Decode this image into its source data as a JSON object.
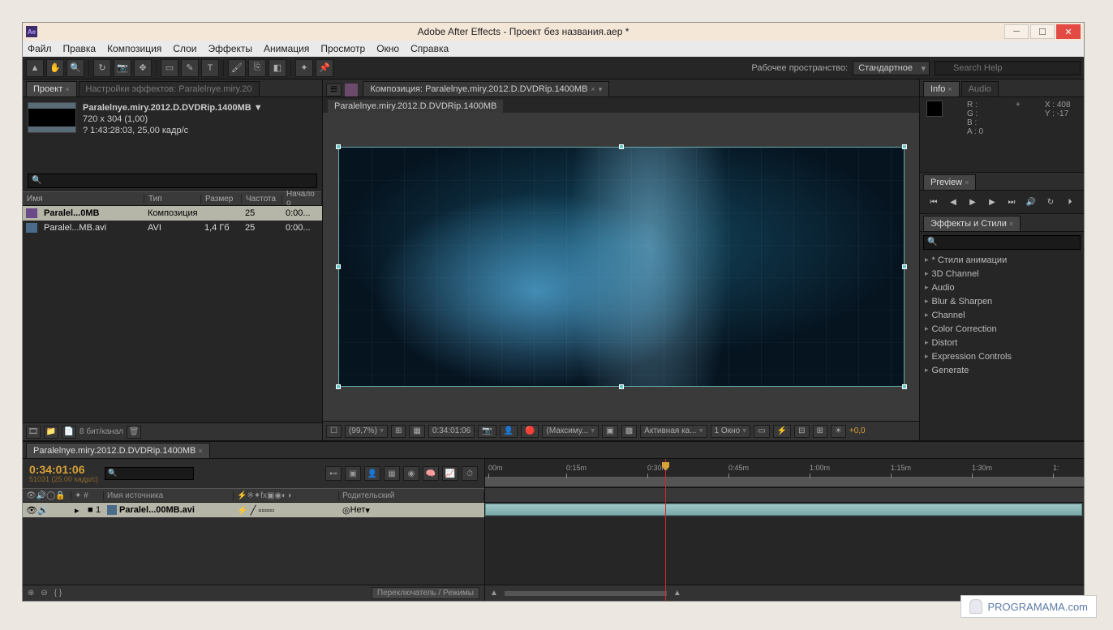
{
  "titlebar": {
    "app_icon": "Ae",
    "title": "Adobe After Effects - Проект без названия.aep *"
  },
  "menubar": [
    "Файл",
    "Правка",
    "Композиция",
    "Слои",
    "Эффекты",
    "Анимация",
    "Просмотр",
    "Окно",
    "Справка"
  ],
  "toolbar": {
    "workspace_label": "Рабочее пространство:",
    "workspace_value": "Стандартное",
    "search_placeholder": "Search Help"
  },
  "project": {
    "tab_project": "Проект",
    "tab_fx": "Настройки эффектов: Paralelnye.miry.20",
    "name": "Paralelnye.miry.2012.D.DVDRip.1400MB ▼",
    "dims": "720 x 304 (1,00)",
    "dur": "? 1:43:28:03, 25,00 кадр/с",
    "cols": {
      "name": "Имя",
      "type": "Тип",
      "size": "Размер",
      "rate": "Частота",
      "start": "Начало о"
    },
    "rows": [
      {
        "sel": true,
        "name": "Paralel...0MB",
        "type": "Композиция",
        "size": "",
        "rate": "25",
        "start": "0:00..."
      },
      {
        "sel": false,
        "name": "Paralel...MB.avi",
        "type": "AVI",
        "size": "1,4 Гб",
        "rate": "25",
        "start": "0:00..."
      }
    ],
    "bpc": "8 бит/канал"
  },
  "composition": {
    "tab": "Композиция: Paralelnye.miry.2012.D.DVDRip.1400MB",
    "subtab": "Paralelnye.miry.2012.D.DVDRip.1400MB",
    "footer": {
      "zoom": "(99,7%)",
      "time": "0:34:01:06",
      "res": "(Максиму...",
      "cam": "Активная ка...",
      "view": "1 Окно",
      "exposure": "+0,0"
    }
  },
  "info": {
    "tab_info": "Info",
    "tab_audio": "Audio",
    "r": "R :",
    "g": "G :",
    "b": "B :",
    "a": "A : 0",
    "x": "X : 408",
    "y": "Y : -17"
  },
  "preview": {
    "tab": "Preview"
  },
  "effects": {
    "tab": "Эффекты и Стили",
    "items": [
      "* Стили анимации",
      "3D Channel",
      "Audio",
      "Blur & Sharpen",
      "Channel",
      "Color Correction",
      "Distort",
      "Expression Controls",
      "Generate"
    ]
  },
  "timeline": {
    "tab": "Paralelnye.miry.2012.D.DVDRip.1400MB",
    "time": "0:34:01:06",
    "frames": "51031 (25.00 кадр/с)",
    "cols": {
      "src": "Имя источника",
      "parent": "Родительский",
      "none": "Нет"
    },
    "layer": {
      "num": "1",
      "name": "Paralel...00MB.avi"
    },
    "ticks": [
      "00m",
      "0:15m",
      "0:30m",
      "0:45m",
      "1:00m",
      "1:15m",
      "1:30m",
      "1:"
    ],
    "footer_toggle": "Переключатель / Режимы"
  },
  "watermark": "PROGRAMAMA.com"
}
